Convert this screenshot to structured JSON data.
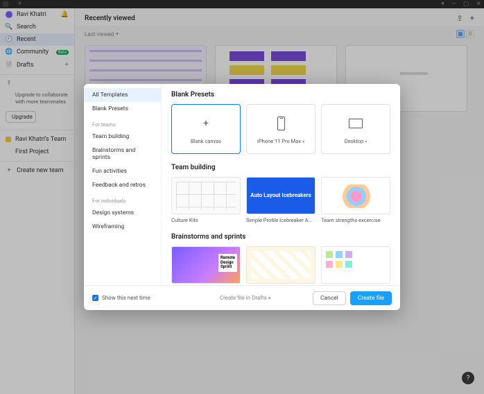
{
  "titlebar": {
    "min": "—",
    "max": "▢",
    "close": "✕"
  },
  "sidebar": {
    "user": "Ravi Khatri",
    "search": "Search",
    "recent": "Recent",
    "community": "Community",
    "community_badge": "Beta",
    "drafts": "Drafts",
    "upgrade_line": "Upgrade to collaborate with more teammates",
    "upgrade_btn": "Upgrade",
    "team": "Ravi Khatri's Team",
    "project": "First Project",
    "create_team": "Create new team"
  },
  "main": {
    "title": "Recently viewed",
    "sort": "Last viewed"
  },
  "modal": {
    "side": {
      "all": "All Templates",
      "blank": "Blank Presets",
      "for_teams": "For teams",
      "team_building": "Team building",
      "brainstorms": "Brainstorms and sprints",
      "fun": "Fun activities",
      "feedback": "Feedback and retros",
      "for_ind": "For individuals",
      "design_sys": "Design systems",
      "wire": "Wireframing"
    },
    "section_blank": "Blank Presets",
    "blank_canvas": "Blank canvas",
    "iphone": "iPhone 11 Pro Max",
    "desktop": "Desktop",
    "section_team": "Team building",
    "culture": "Culture Kits",
    "auto_layout": "Simple Profile Icebreaker A...",
    "auto_layout_thumb": "Auto Layout Icebreakers",
    "strengths": "Team strengths excercise",
    "section_brain": "Brainstorms and sprints"
  },
  "footer": {
    "show_next": "Show this next time",
    "create_in": "Create file in Drafts",
    "cancel": "Cancel",
    "create": "Create file"
  }
}
